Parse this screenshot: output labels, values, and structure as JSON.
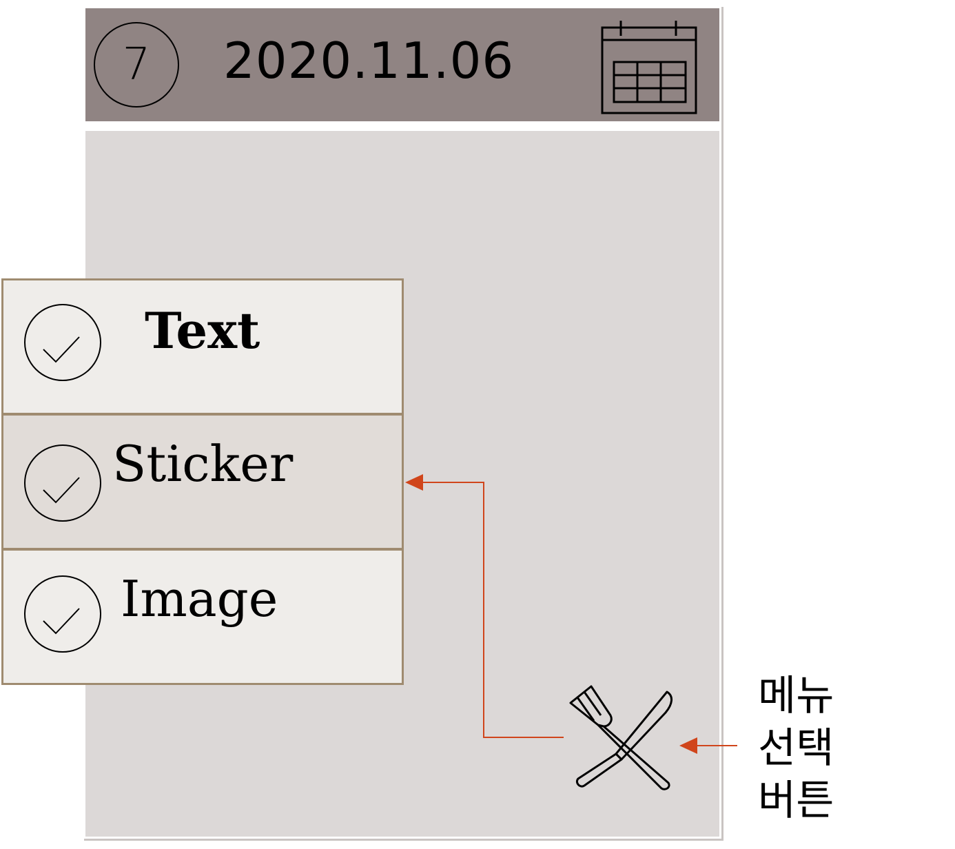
{
  "header": {
    "step_number": "7",
    "date": "2020.11.06",
    "calendar_icon": "calendar-icon"
  },
  "menu": {
    "items": [
      {
        "label": "Text",
        "icon": "check-circle-icon"
      },
      {
        "label": "Sticker",
        "icon": "check-circle-icon"
      },
      {
        "label": "Image",
        "icon": "check-circle-icon"
      }
    ]
  },
  "menu_button": {
    "icon": "fork-knife-icon"
  },
  "annotation": {
    "lines": [
      "메뉴",
      "선택",
      "버튼"
    ],
    "arrow_color": "#d0451b"
  },
  "colors": {
    "header_bg": "#908483",
    "content_bg": "#dcd8d7",
    "menu_border": "#9f8b70",
    "menu_item_bg": "#efedea",
    "menu_item_active_bg": "#e1dcd8"
  }
}
